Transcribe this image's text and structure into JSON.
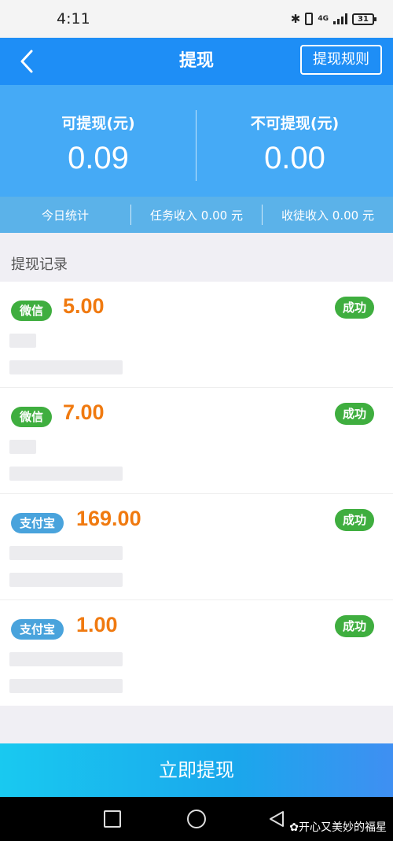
{
  "status_bar": {
    "time": "4:11",
    "network": "4G",
    "battery": "31"
  },
  "nav": {
    "title": "提现",
    "rules_label": "提现规则"
  },
  "balance": {
    "withdrawable_label": "可提现(元)",
    "withdrawable_value": "0.09",
    "non_withdrawable_label": "不可提现(元)",
    "non_withdrawable_value": "0.00"
  },
  "stats": {
    "today": "今日统计",
    "task_income": "任务收入 0.00 元",
    "apprentice_income": "收徒收入 0.00 元"
  },
  "records": {
    "title": "提现记录",
    "items": [
      {
        "channel": "微信",
        "amount": "5.00",
        "status": "成功"
      },
      {
        "channel": "微信",
        "amount": "7.00",
        "status": "成功"
      },
      {
        "channel": "支付宝",
        "amount": "169.00",
        "status": "成功"
      },
      {
        "channel": "支付宝",
        "amount": "1.00",
        "status": "成功"
      }
    ]
  },
  "withdraw_button": "立即提现",
  "watermark": "开心又美妙的福星",
  "colors": {
    "primary": "#1e8ef6",
    "card": "#45aaf6",
    "amount": "#f07a10",
    "success": "#3fae3f",
    "alipay": "#49a3dc"
  }
}
